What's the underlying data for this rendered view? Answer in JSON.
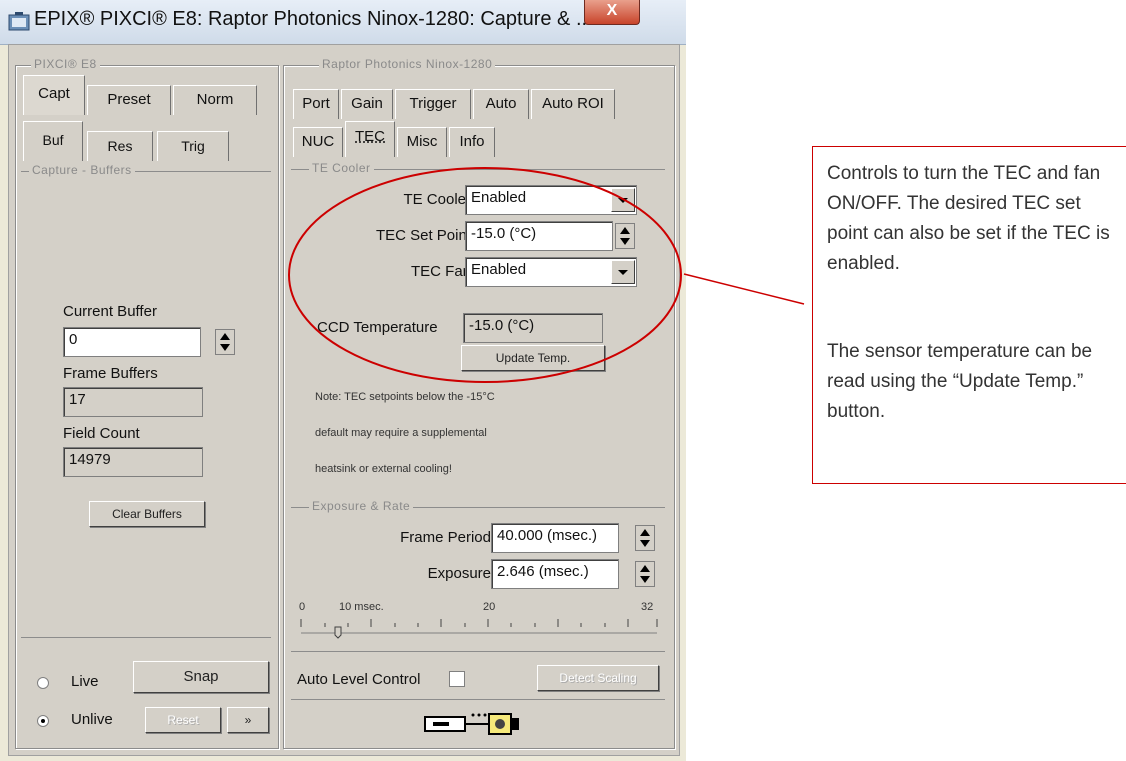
{
  "window": {
    "title": "EPIX® PIXCI® E8: Raptor Photonics Ninox-1280: Capture & ...",
    "close_label": "X"
  },
  "left_panel": {
    "group_title": "PIXCI® E8",
    "tabs_row1": [
      "Capt",
      "Preset",
      "Norm"
    ],
    "tabs_row2": [
      "Buf",
      "Res",
      "Trig"
    ],
    "subgroup_title": "Capture - Buffers",
    "current_buffer_label": "Current Buffer",
    "current_buffer_value": "0",
    "frame_buffers_label": "Frame Buffers",
    "frame_buffers_value": "17",
    "field_count_label": "Field Count",
    "field_count_value": "14979",
    "clear_buffers_label": "Clear Buffers",
    "live_label": "Live",
    "unlive_label": "Unlive",
    "snap_label": "Snap",
    "reset_label": "Reset",
    "arrow_label": "»"
  },
  "right_panel": {
    "group_title": "Raptor Photonics Ninox-1280",
    "tabs_row1": [
      "Port",
      "Gain",
      "Trigger",
      "Auto",
      "Auto ROI"
    ],
    "tabs_row2": [
      "NUC",
      "TEC",
      "Misc",
      "Info"
    ],
    "te_group_title": "TE Cooler",
    "te_cooler_label": "TE Cooler",
    "te_cooler_value": "Enabled",
    "tec_setpoint_label": "TEC Set Point",
    "tec_setpoint_value": "-15.0 (°C)",
    "tec_fan_label": "TEC Fan",
    "tec_fan_value": "Enabled",
    "ccd_temp_label": "CCD Temperature",
    "ccd_temp_value": "-15.0 (°C)",
    "update_temp_label": "Update Temp.",
    "note_line1": "Note: TEC setpoints below the -15°C",
    "note_line2": "default may require a supplemental",
    "note_line3": "heatsink or external cooling!",
    "exposure_group_title": "Exposure & Rate",
    "frame_period_label": "Frame Period",
    "frame_period_value": "40.000 (msec.)",
    "exposure_label": "Exposure",
    "exposure_value": "2.646 (msec.)",
    "scale_0": "0",
    "scale_10": "10 msec.",
    "scale_20": "20",
    "scale_32": "32",
    "auto_level_label": "Auto Level Control",
    "disabled_button_label": "Detect Scaling"
  },
  "annotation": {
    "text1": "Controls to turn the TEC and fan ON/OFF. The desired TEC set point can also be set if the TEC is enabled.",
    "text2": "The sensor temperature can be read using the “Update Temp.” button.",
    "color": "#cc0000"
  }
}
